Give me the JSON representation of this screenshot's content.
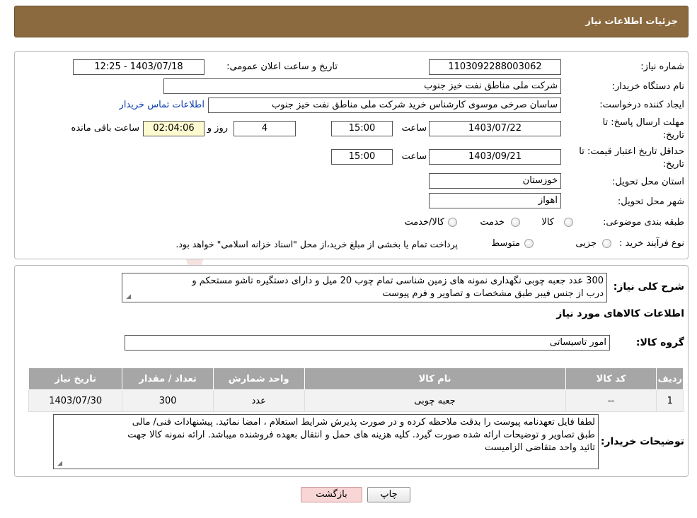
{
  "header": {
    "title": "جزئیات اطلاعات نیاز"
  },
  "labels": {
    "need_number": "شماره نیاز:",
    "announce_datetime": "تاریخ و ساعت اعلان عمومی:",
    "buyer_org": "نام دستگاه خریدار:",
    "requester": "ایجاد کننده درخواست:",
    "reply_deadline_1": "مهلت ارسال پاسخ: تا",
    "reply_deadline_2": "تاریخ:",
    "price_validity_1": "حداقل تاریخ اعتبار قیمت: تا",
    "price_validity_2": "تاریخ:",
    "time": "ساعت",
    "days_and": "روز و",
    "remaining": "ساعت باقی مانده",
    "province": "استان محل تحویل:",
    "city": "شهر محل تحویل:",
    "category": "طبقه بندی موضوعی:",
    "purchase_type": "نوع فرآیند خرید :",
    "description": "شرح کلی نیاز:",
    "goods_info": "اطلاعات کالاهای مورد نیاز",
    "goods_group": "گروه کالا:",
    "buyer_notes": "توضیحات خریدار:"
  },
  "fields": {
    "need_number": "1103092288003062",
    "announce_datetime": "1403/07/18 - 12:25",
    "buyer_org": "شرکت ملی مناطق نفت خیز جنوب",
    "requester": "ساسان صرخی موسوی کارشناس خرید  شرکت ملی مناطق نفت خیز جنوب",
    "contact_link": "اطلاعات تماس خریدار",
    "reply_date": "1403/07/22",
    "reply_time": "15:00",
    "days_left": "4",
    "time_left": "02:04:06",
    "validity_date": "1403/09/21",
    "validity_time": "15:00",
    "province": "خوزستان",
    "city": "اهواز",
    "goods_group": "امور تاسیساتی"
  },
  "category_options": [
    "کالا",
    "خدمت",
    "کالا/خدمت"
  ],
  "purchase_options": [
    "جزیی",
    "متوسط"
  ],
  "purchase_note": "پرداخت تمام یا بخشی از مبلغ خرید،از محل \"اسناد خزانه اسلامی\" خواهد بود.",
  "description_lines": [
    "300 عدد جعبه چوبی نگهداری نمونه های زمین شناسی تمام چوب 20 میل و دارای دستگیره تاشو مستحکم و",
    "درب از جنس فیبر طبق مشخصات و تصاویر و فرم پیوست"
  ],
  "table": {
    "headers": [
      "ردیف",
      "کد کالا",
      "نام کالا",
      "واحد شمارش",
      "تعداد / مقدار",
      "تاریخ نیاز"
    ],
    "rows": [
      [
        "1",
        "--",
        "جعبه چوبی",
        "عدد",
        "300",
        "1403/07/30"
      ]
    ]
  },
  "buyer_notes_lines": [
    "لطفا فایل تعهدنامه پیوست را بدقت ملاحظه کرده و در صورت پذیرش شرایط استعلام ، امضا نمائید. پیشنهادات فنی/ مالی",
    "طبق تصاویر و توضیحات ارائه شده صورت گیرد. کلیه هزینه های حمل و انتقال بعهده فروشنده میباشد. ارائه نمونه کالا جهت",
    "تائید واحد متقاضی الزامیست"
  ],
  "buttons": {
    "print": "چاپ",
    "back": "بازگشت"
  },
  "colors": {
    "header_bg": "#8c6a3f",
    "table_header_bg": "#a6a6a6",
    "back_button_bg": "#f9d6d6",
    "link": "#0a3dad"
  }
}
